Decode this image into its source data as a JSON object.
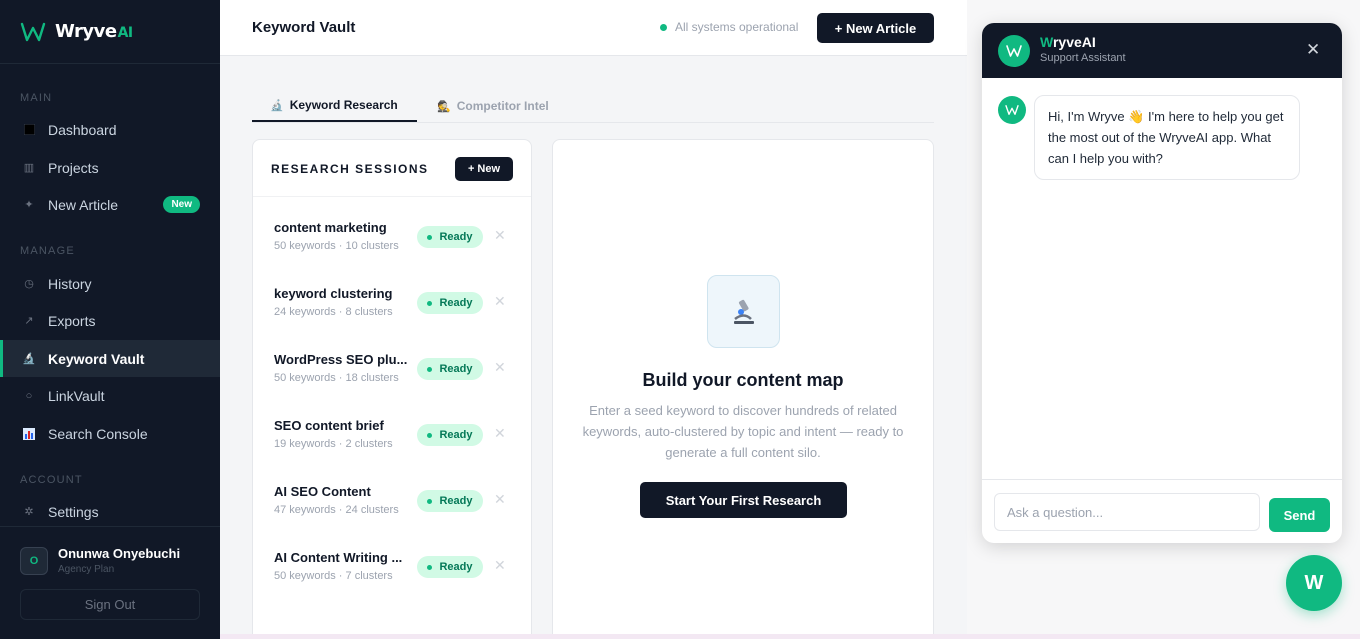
{
  "brand": {
    "name": "Wryve",
    "suffix": "AI"
  },
  "sidebar": {
    "sections": {
      "main": "MAIN",
      "manage": "MANAGE",
      "account": "ACCOUNT"
    },
    "items": [
      {
        "label": "Dashboard",
        "icon": "dashboard-icon"
      },
      {
        "label": "Projects",
        "icon": "projects-icon"
      },
      {
        "label": "New Article",
        "icon": "sparkle-icon",
        "badge": "New"
      },
      {
        "label": "History",
        "icon": "clock-icon"
      },
      {
        "label": "Exports",
        "icon": "export-icon"
      },
      {
        "label": "Keyword Vault",
        "icon": "microscope-icon",
        "active": true
      },
      {
        "label": "LinkVault",
        "icon": "link-icon"
      },
      {
        "label": "Search Console",
        "icon": "chart-icon"
      },
      {
        "label": "Settings",
        "icon": "gear-icon"
      }
    ],
    "user": {
      "initial": "O",
      "name": "Onunwa Onyebuchi",
      "plan": "Agency Plan",
      "signout": "Sign Out"
    }
  },
  "header": {
    "title": "Keyword Vault",
    "status": "All systems operational",
    "new_article": "+ New Article"
  },
  "tabs": [
    {
      "label": "Keyword Research",
      "icon": "🔬"
    },
    {
      "label": "Competitor Intel",
      "icon": "🕵"
    }
  ],
  "sessions": {
    "title": "RESEARCH SESSIONS",
    "new_label": "+ New",
    "items": [
      {
        "name": "content marketing",
        "meta": "50 keywords · 10 clusters",
        "status": "Ready"
      },
      {
        "name": "keyword clustering",
        "meta": "24 keywords · 8 clusters",
        "status": "Ready"
      },
      {
        "name": "WordPress SEO plu...",
        "meta": "50 keywords · 18 clusters",
        "status": "Ready"
      },
      {
        "name": "SEO content brief",
        "meta": "19 keywords · 2 clusters",
        "status": "Ready"
      },
      {
        "name": "AI SEO Content",
        "meta": "47 keywords · 24 clusters",
        "status": "Ready"
      },
      {
        "name": "AI Content Writing ...",
        "meta": "50 keywords · 7 clusters",
        "status": "Ready"
      }
    ]
  },
  "empty_state": {
    "title": "Build your content map",
    "description": "Enter a seed keyword to discover hundreds of related keywords, auto-clustered by topic and intent — ready to generate a full content silo.",
    "cta": "Start Your First Research"
  },
  "chat": {
    "title_first": "W",
    "title_rest": "ryveAI",
    "subtitle": "Support Assistant",
    "message": "Hi, I'm Wryve 👋 I'm here to help you get the most out of the WryveAI app. What can I help you with?",
    "input_placeholder": "Ask a question...",
    "send": "Send",
    "fab": "W"
  },
  "colors": {
    "accent": "#10b981",
    "sidebar": "#111827",
    "dark_button": "#111827"
  }
}
